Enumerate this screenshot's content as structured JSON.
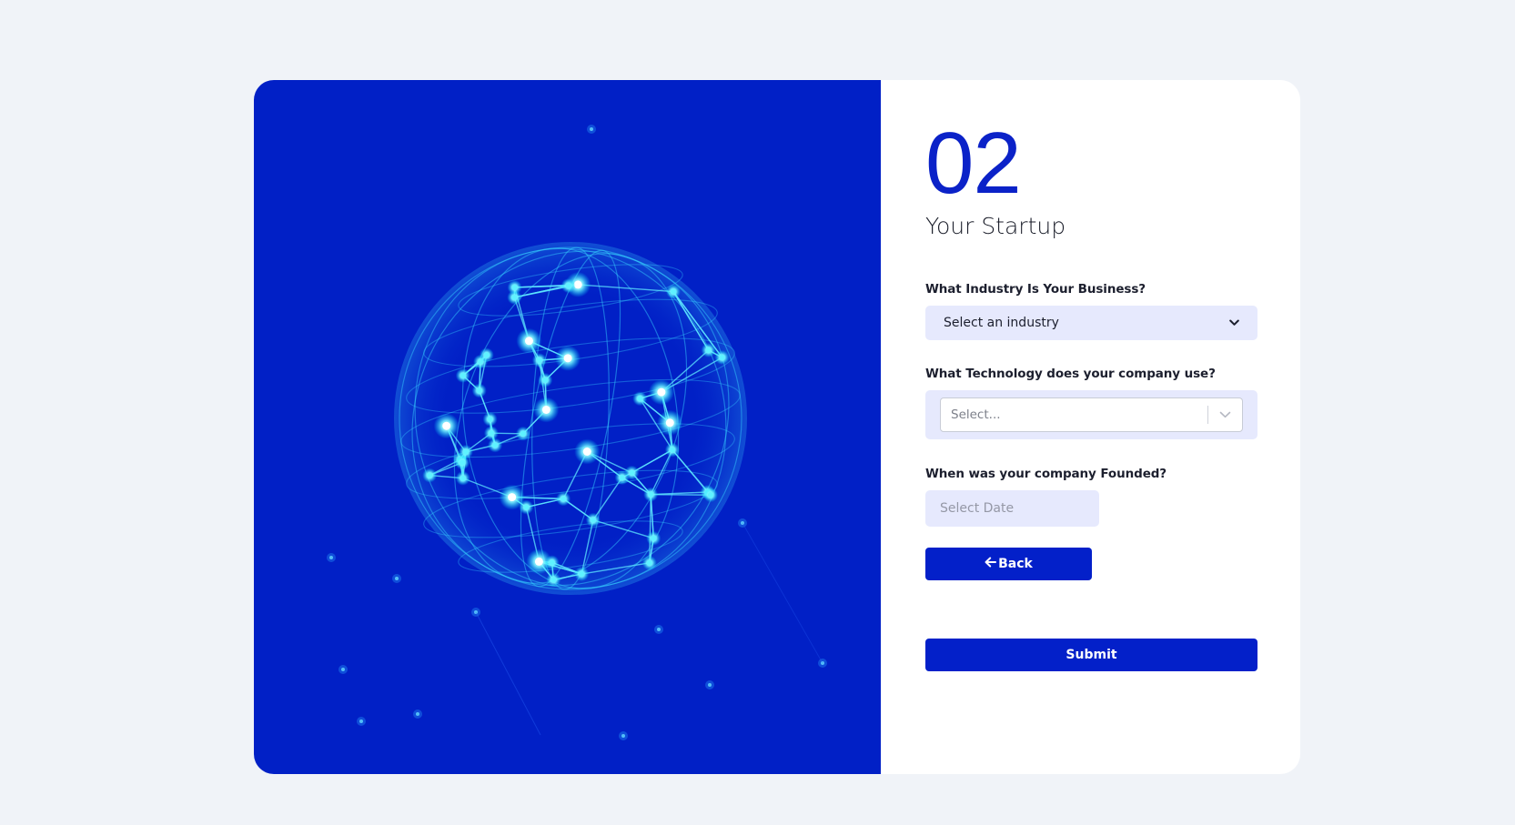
{
  "colors": {
    "page_background": "#f0f3f8",
    "accent": "#0320c9",
    "hero_background": "#0120c6",
    "field_background": "#e6e9fd"
  },
  "hero": {
    "image_icon": "network-globe-icon"
  },
  "step": {
    "number": "02",
    "title": "Your Startup"
  },
  "fields": {
    "industry": {
      "label": "What Industry Is Your Business?",
      "selected": "Select an industry",
      "icon": "chevron-down-icon"
    },
    "technology": {
      "label": "What Technology does your company use?",
      "placeholder": "Select...",
      "icon": "chevron-down-icon"
    },
    "founded": {
      "label": "When was your company Founded?",
      "placeholder": "Select Date",
      "value": ""
    }
  },
  "buttons": {
    "back": {
      "label": "Back",
      "icon": "arrow-left-icon"
    },
    "submit": {
      "label": "Submit"
    }
  }
}
